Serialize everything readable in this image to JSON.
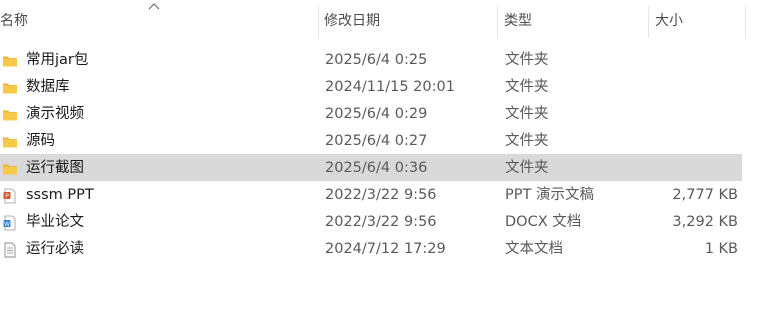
{
  "columns": {
    "name": "名称",
    "date": "修改日期",
    "type": "类型",
    "size": "大小"
  },
  "sort": {
    "column": "name",
    "direction": "ascending",
    "icon": "sort-up-icon"
  },
  "selected_index": 4,
  "files": [
    {
      "icon": "folder-icon",
      "name": "常用jar包",
      "date": "2025/6/4 0:25",
      "type": "文件夹",
      "size": ""
    },
    {
      "icon": "folder-icon",
      "name": "数据库",
      "date": "2024/11/15 20:01",
      "type": "文件夹",
      "size": ""
    },
    {
      "icon": "folder-icon",
      "name": "演示视频",
      "date": "2025/6/4 0:29",
      "type": "文件夹",
      "size": ""
    },
    {
      "icon": "folder-icon",
      "name": "源码",
      "date": "2025/6/4 0:27",
      "type": "文件夹",
      "size": ""
    },
    {
      "icon": "folder-icon",
      "name": "运行截图",
      "date": "2025/6/4 0:36",
      "type": "文件夹",
      "size": ""
    },
    {
      "icon": "ppt-file-icon",
      "name": "sssm PPT",
      "date": "2022/3/22 9:56",
      "type": "PPT 演示文稿",
      "size": "2,777 KB"
    },
    {
      "icon": "word-file-icon",
      "name": "毕业论文",
      "date": "2022/3/22 9:56",
      "type": "DOCX 文档",
      "size": "3,292 KB"
    },
    {
      "icon": "text-file-icon",
      "name": "运行必读",
      "date": "2024/7/12 17:29",
      "type": "文本文档",
      "size": "1 KB"
    }
  ],
  "colors": {
    "selection": "#d9d9d9",
    "folder": "#f7c948",
    "ppt": "#d35230",
    "word": "#2b7cd3"
  }
}
